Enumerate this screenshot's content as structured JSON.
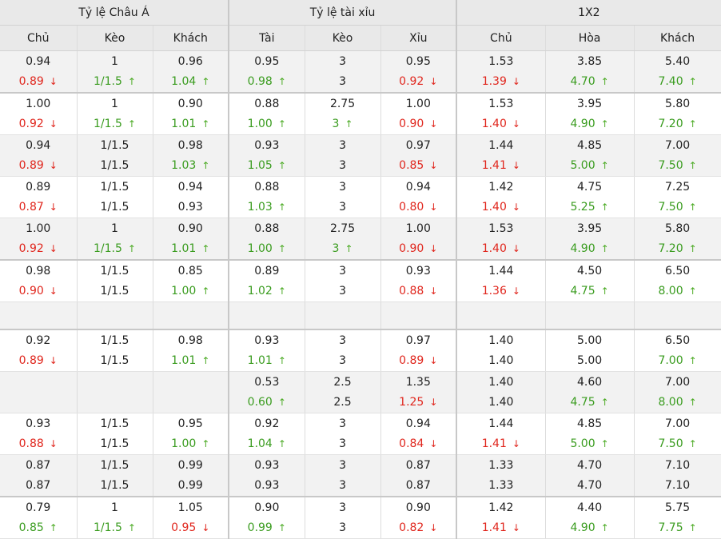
{
  "header": {
    "groups": [
      "Tỷ lệ Châu Á",
      "Tỷ lệ tài xỉu",
      "1X2"
    ],
    "columns": [
      "Chủ",
      "Kèo",
      "Khách",
      "Tài",
      "Kèo",
      "Xỉu",
      "Chủ",
      "Hòa",
      "Khách"
    ]
  },
  "colors": {
    "up": "#3a9c1f",
    "down": "#e0261d"
  },
  "rows": [
    {
      "shade": true,
      "thick": true,
      "cells": [
        {
          "top": "0.94",
          "bottom": "0.89",
          "dir": "down"
        },
        {
          "top": "1",
          "bottom": "1/1.5",
          "dir": "up"
        },
        {
          "top": "0.96",
          "bottom": "1.04",
          "dir": "up"
        },
        {
          "top": "0.95",
          "bottom": "0.98",
          "dir": "up"
        },
        {
          "top": "3",
          "bottom": "3",
          "dir": ""
        },
        {
          "top": "0.95",
          "bottom": "0.92",
          "dir": "down"
        },
        {
          "top": "1.53",
          "bottom": "1.39",
          "dir": "down"
        },
        {
          "top": "3.85",
          "bottom": "4.70",
          "dir": "up"
        },
        {
          "top": "5.40",
          "bottom": "7.40",
          "dir": "up"
        }
      ]
    },
    {
      "shade": false,
      "thick": false,
      "cells": [
        {
          "top": "1.00",
          "bottom": "0.92",
          "dir": "down"
        },
        {
          "top": "1",
          "bottom": "1/1.5",
          "dir": "up"
        },
        {
          "top": "0.90",
          "bottom": "1.01",
          "dir": "up"
        },
        {
          "top": "0.88",
          "bottom": "1.00",
          "dir": "up"
        },
        {
          "top": "2.75",
          "bottom": "3",
          "dir": "up"
        },
        {
          "top": "1.00",
          "bottom": "0.90",
          "dir": "down"
        },
        {
          "top": "1.53",
          "bottom": "1.40",
          "dir": "down"
        },
        {
          "top": "3.95",
          "bottom": "4.90",
          "dir": "up"
        },
        {
          "top": "5.80",
          "bottom": "7.20",
          "dir": "up"
        }
      ]
    },
    {
      "shade": true,
      "thick": false,
      "cells": [
        {
          "top": "0.94",
          "bottom": "0.89",
          "dir": "down"
        },
        {
          "top": "1/1.5",
          "bottom": "1/1.5",
          "dir": ""
        },
        {
          "top": "0.98",
          "bottom": "1.03",
          "dir": "up"
        },
        {
          "top": "0.93",
          "bottom": "1.05",
          "dir": "up"
        },
        {
          "top": "3",
          "bottom": "3",
          "dir": ""
        },
        {
          "top": "0.97",
          "bottom": "0.85",
          "dir": "down"
        },
        {
          "top": "1.44",
          "bottom": "1.41",
          "dir": "down"
        },
        {
          "top": "4.85",
          "bottom": "5.00",
          "dir": "up"
        },
        {
          "top": "7.00",
          "bottom": "7.50",
          "dir": "up"
        }
      ]
    },
    {
      "shade": false,
      "thick": false,
      "cells": [
        {
          "top": "0.89",
          "bottom": "0.87",
          "dir": "down"
        },
        {
          "top": "1/1.5",
          "bottom": "1/1.5",
          "dir": ""
        },
        {
          "top": "0.94",
          "bottom": "0.93",
          "dir": ""
        },
        {
          "top": "0.88",
          "bottom": "1.03",
          "dir": "up"
        },
        {
          "top": "3",
          "bottom": "3",
          "dir": ""
        },
        {
          "top": "0.94",
          "bottom": "0.80",
          "dir": "down"
        },
        {
          "top": "1.42",
          "bottom": "1.40",
          "dir": "down"
        },
        {
          "top": "4.75",
          "bottom": "5.25",
          "dir": "up"
        },
        {
          "top": "7.25",
          "bottom": "7.50",
          "dir": "up"
        }
      ]
    },
    {
      "shade": true,
      "thick": true,
      "cells": [
        {
          "top": "1.00",
          "bottom": "0.92",
          "dir": "down"
        },
        {
          "top": "1",
          "bottom": "1/1.5",
          "dir": "up"
        },
        {
          "top": "0.90",
          "bottom": "1.01",
          "dir": "up"
        },
        {
          "top": "0.88",
          "bottom": "1.00",
          "dir": "up"
        },
        {
          "top": "2.75",
          "bottom": "3",
          "dir": "up"
        },
        {
          "top": "1.00",
          "bottom": "0.90",
          "dir": "down"
        },
        {
          "top": "1.53",
          "bottom": "1.40",
          "dir": "down"
        },
        {
          "top": "3.95",
          "bottom": "4.90",
          "dir": "up"
        },
        {
          "top": "5.80",
          "bottom": "7.20",
          "dir": "up"
        }
      ]
    },
    {
      "shade": false,
      "thick": false,
      "cells": [
        {
          "top": "0.98",
          "bottom": "0.90",
          "dir": "down"
        },
        {
          "top": "1/1.5",
          "bottom": "1/1.5",
          "dir": ""
        },
        {
          "top": "0.85",
          "bottom": "1.00",
          "dir": "up"
        },
        {
          "top": "0.89",
          "bottom": "1.02",
          "dir": "up"
        },
        {
          "top": "3",
          "bottom": "3",
          "dir": ""
        },
        {
          "top": "0.93",
          "bottom": "0.88",
          "dir": "down"
        },
        {
          "top": "1.44",
          "bottom": "1.36",
          "dir": "down"
        },
        {
          "top": "4.50",
          "bottom": "4.75",
          "dir": "up"
        },
        {
          "top": "6.50",
          "bottom": "8.00",
          "dir": "up"
        }
      ]
    },
    {
      "shade": true,
      "thick": true,
      "empty": true,
      "cells": [
        {
          "top": "",
          "bottom": "",
          "dir": ""
        },
        {
          "top": "",
          "bottom": "",
          "dir": ""
        },
        {
          "top": "",
          "bottom": "",
          "dir": ""
        },
        {
          "top": "",
          "bottom": "",
          "dir": ""
        },
        {
          "top": "",
          "bottom": "",
          "dir": ""
        },
        {
          "top": "",
          "bottom": "",
          "dir": ""
        },
        {
          "top": "",
          "bottom": "",
          "dir": ""
        },
        {
          "top": "",
          "bottom": "",
          "dir": ""
        },
        {
          "top": "",
          "bottom": "",
          "dir": ""
        }
      ]
    },
    {
      "shade": false,
      "thick": false,
      "cells": [
        {
          "top": "0.92",
          "bottom": "0.89",
          "dir": "down"
        },
        {
          "top": "1/1.5",
          "bottom": "1/1.5",
          "dir": ""
        },
        {
          "top": "0.98",
          "bottom": "1.01",
          "dir": "up"
        },
        {
          "top": "0.93",
          "bottom": "1.01",
          "dir": "up"
        },
        {
          "top": "3",
          "bottom": "3",
          "dir": ""
        },
        {
          "top": "0.97",
          "bottom": "0.89",
          "dir": "down"
        },
        {
          "top": "1.40",
          "bottom": "1.40",
          "dir": ""
        },
        {
          "top": "5.00",
          "bottom": "5.00",
          "dir": ""
        },
        {
          "top": "6.50",
          "bottom": "7.00",
          "dir": "up"
        }
      ]
    },
    {
      "shade": true,
      "thick": false,
      "cells": [
        {
          "top": "",
          "bottom": "",
          "dir": ""
        },
        {
          "top": "",
          "bottom": "",
          "dir": ""
        },
        {
          "top": "",
          "bottom": "",
          "dir": ""
        },
        {
          "top": "0.53",
          "bottom": "0.60",
          "dir": "up"
        },
        {
          "top": "2.5",
          "bottom": "2.5",
          "dir": ""
        },
        {
          "top": "1.35",
          "bottom": "1.25",
          "dir": "down"
        },
        {
          "top": "1.40",
          "bottom": "1.40",
          "dir": ""
        },
        {
          "top": "4.60",
          "bottom": "4.75",
          "dir": "up"
        },
        {
          "top": "7.00",
          "bottom": "8.00",
          "dir": "up"
        }
      ]
    },
    {
      "shade": false,
      "thick": false,
      "cells": [
        {
          "top": "0.93",
          "bottom": "0.88",
          "dir": "down"
        },
        {
          "top": "1/1.5",
          "bottom": "1/1.5",
          "dir": ""
        },
        {
          "top": "0.95",
          "bottom": "1.00",
          "dir": "up"
        },
        {
          "top": "0.92",
          "bottom": "1.04",
          "dir": "up"
        },
        {
          "top": "3",
          "bottom": "3",
          "dir": ""
        },
        {
          "top": "0.94",
          "bottom": "0.84",
          "dir": "down"
        },
        {
          "top": "1.44",
          "bottom": "1.41",
          "dir": "down"
        },
        {
          "top": "4.85",
          "bottom": "5.00",
          "dir": "up"
        },
        {
          "top": "7.00",
          "bottom": "7.50",
          "dir": "up"
        }
      ]
    },
    {
      "shade": true,
      "thick": true,
      "cells": [
        {
          "top": "0.87",
          "bottom": "0.87",
          "dir": ""
        },
        {
          "top": "1/1.5",
          "bottom": "1/1.5",
          "dir": ""
        },
        {
          "top": "0.99",
          "bottom": "0.99",
          "dir": ""
        },
        {
          "top": "0.93",
          "bottom": "0.93",
          "dir": ""
        },
        {
          "top": "3",
          "bottom": "3",
          "dir": ""
        },
        {
          "top": "0.87",
          "bottom": "0.87",
          "dir": ""
        },
        {
          "top": "1.33",
          "bottom": "1.33",
          "dir": ""
        },
        {
          "top": "4.70",
          "bottom": "4.70",
          "dir": ""
        },
        {
          "top": "7.10",
          "bottom": "7.10",
          "dir": ""
        }
      ]
    },
    {
      "shade": false,
      "thick": false,
      "cells": [
        {
          "top": "0.79",
          "bottom": "0.85",
          "dir": "up"
        },
        {
          "top": "1",
          "bottom": "1/1.5",
          "dir": "up"
        },
        {
          "top": "1.05",
          "bottom": "0.95",
          "dir": "down"
        },
        {
          "top": "0.90",
          "bottom": "0.99",
          "dir": "up"
        },
        {
          "top": "3",
          "bottom": "3",
          "dir": ""
        },
        {
          "top": "0.90",
          "bottom": "0.82",
          "dir": "down"
        },
        {
          "top": "1.42",
          "bottom": "1.41",
          "dir": "down"
        },
        {
          "top": "4.40",
          "bottom": "4.90",
          "dir": "up"
        },
        {
          "top": "5.75",
          "bottom": "7.75",
          "dir": "up"
        }
      ]
    }
  ]
}
